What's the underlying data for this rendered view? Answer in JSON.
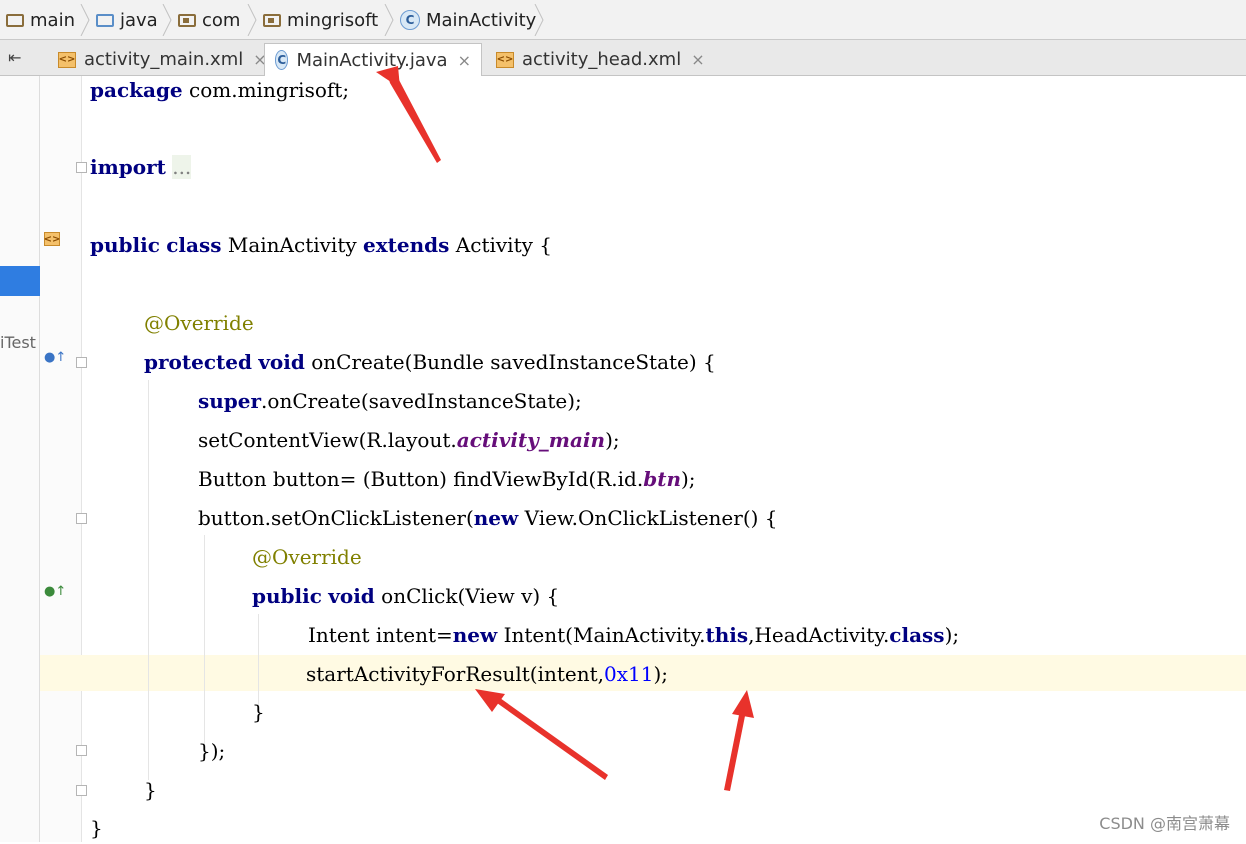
{
  "breadcrumbs": [
    {
      "label": "main",
      "icon": "folder-icon"
    },
    {
      "label": "java",
      "icon": "source-folder-icon"
    },
    {
      "label": "com",
      "icon": "package-icon"
    },
    {
      "label": "mingrisoft",
      "icon": "package-icon"
    },
    {
      "label": "MainActivity",
      "icon": "class-icon"
    }
  ],
  "tabs": [
    {
      "label": "activity_main.xml",
      "icon": "xml-file-icon",
      "active": false
    },
    {
      "label": "MainActivity.java",
      "icon": "class-icon",
      "active": true
    },
    {
      "label": "activity_head.xml",
      "icon": "xml-file-icon",
      "active": false
    }
  ],
  "left_panel": {
    "test_label": "iTest"
  },
  "code": {
    "package_kw": "package",
    "package_name": "com.mingrisoft;",
    "import_kw": "import",
    "import_fold": "...",
    "class_decl": {
      "kw1": "public",
      "kw2": "class",
      "name": "MainActivity",
      "kw3": "extends",
      "parent": "Activity {"
    },
    "override1": "@Override",
    "oncreate": {
      "kw1": "protected",
      "kw2": "void",
      "sig": "onCreate(Bundle savedInstanceState) {"
    },
    "super_call": {
      "kw": "super",
      "rest": ".onCreate(savedInstanceState);"
    },
    "setcontent": {
      "pre": "setContentView(R.layout.",
      "field": "activity_main",
      "post": ");"
    },
    "button_line": {
      "pre": "Button button= (Button) findViewById(R.id.",
      "field": "btn",
      "post": ");"
    },
    "listener": {
      "pre": "button.setOnClickListener(",
      "kw": "new",
      "post": " View.OnClickListener() {"
    },
    "override2": "@Override",
    "onclick": {
      "kw1": "public",
      "kw2": "void",
      "sig": "onClick(View v) {"
    },
    "intent_line": {
      "pre": "Intent intent=",
      "kw1": "new",
      "mid": " Intent(MainActivity.",
      "kw2": "this",
      "mid2": ",HeadActivity.",
      "kw3": "class",
      "post": ");"
    },
    "start_line": {
      "pre": "startActivityForResult(intent,",
      "num": "0x11",
      "post": ");"
    },
    "close1": "}",
    "close2": "});",
    "close3": "}",
    "close4": "}"
  },
  "watermark": "CSDN @南宫萧幕",
  "colors": {
    "keyword": "#000080",
    "annotation": "#808000",
    "field": "#660e7a",
    "number": "#0000ff",
    "arrow": "#e8322b",
    "selection": "#2f7de1"
  }
}
